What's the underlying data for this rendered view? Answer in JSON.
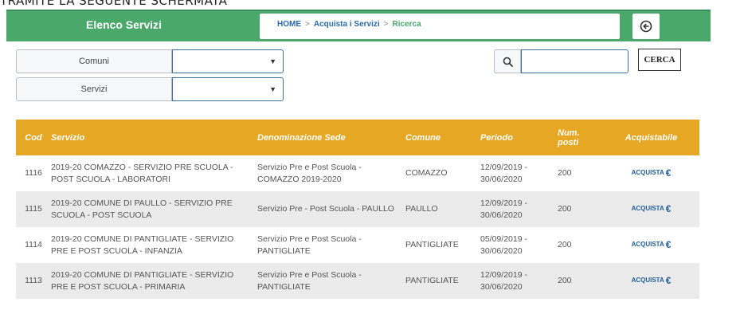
{
  "top_text": "TRAMITE LA SEGUENTE SCHERMATA",
  "header": {
    "title": "Elenco Servizi",
    "breadcrumb": {
      "home": "HOME",
      "separator": ">",
      "acquista": "Acquista i Servizi",
      "current": "Ricerca"
    },
    "back_icon": "circle-arrow-left-icon"
  },
  "filters": {
    "comuni_label": "Comuni",
    "servizi_label": "Servizi",
    "comuni_value": "",
    "servizi_value": ""
  },
  "search": {
    "icon": "search-icon",
    "value": "",
    "button_label": "CERCA"
  },
  "table": {
    "headers": {
      "cod": "Cod",
      "servizio": "Servizio",
      "sede": "Denominazione Sede",
      "comune": "Comune",
      "periodo": "Periodo",
      "num_posti": "Num. posti",
      "acquistabile": "Acquistabile"
    },
    "rows": [
      {
        "cod": "1116",
        "servizio": "2019-20 COMAZZO - SERVIZIO PRE SCUOLA - POST SCUOLA - LABORATORI",
        "sede": "Servizio Pre e Post Scuola - COMAZZO 2019-2020",
        "comune": "COMAZZO",
        "periodo": "12/09/2019 - 30/06/2020",
        "num_posti": "200",
        "acquista": "ACQUISTA"
      },
      {
        "cod": "1115",
        "servizio": "2019-20 COMUNE DI PAULLO - SERVIZIO PRE SCUOLA - POST SCUOLA",
        "sede": "Servizio Pre - Post Scuola - PAULLO",
        "comune": "PAULLO",
        "periodo": "12/09/2019 - 30/06/2020",
        "num_posti": "200",
        "acquista": "ACQUISTA"
      },
      {
        "cod": "1114",
        "servizio": "2019-20 COMUNE DI PANTIGLIATE - SERVIZIO PRE E POST SCUOLA - INFANZIA",
        "sede": "Servizio Pre e Post Scuola - PANTIGLIATE",
        "comune": "PANTIGLIATE",
        "periodo": "05/09/2019 - 30/06/2020",
        "num_posti": "200",
        "acquista": "ACQUISTA"
      },
      {
        "cod": "1113",
        "servizio": "2019-20 COMUNE DI PANTIGLIATE - SERVIZIO PRE E POST SCUOLA - PRIMARIA",
        "sede": "Servizio Pre e Post Scuola - PANTIGLIATE",
        "comune": "PANTIGLIATE",
        "periodo": "12/09/2019 - 30/06/2020",
        "num_posti": "200",
        "acquista": "ACQUISTA"
      }
    ]
  },
  "colors": {
    "header_green": "#4aa86b",
    "table_header_orange": "#e6a725",
    "link_blue": "#1f5d99"
  }
}
